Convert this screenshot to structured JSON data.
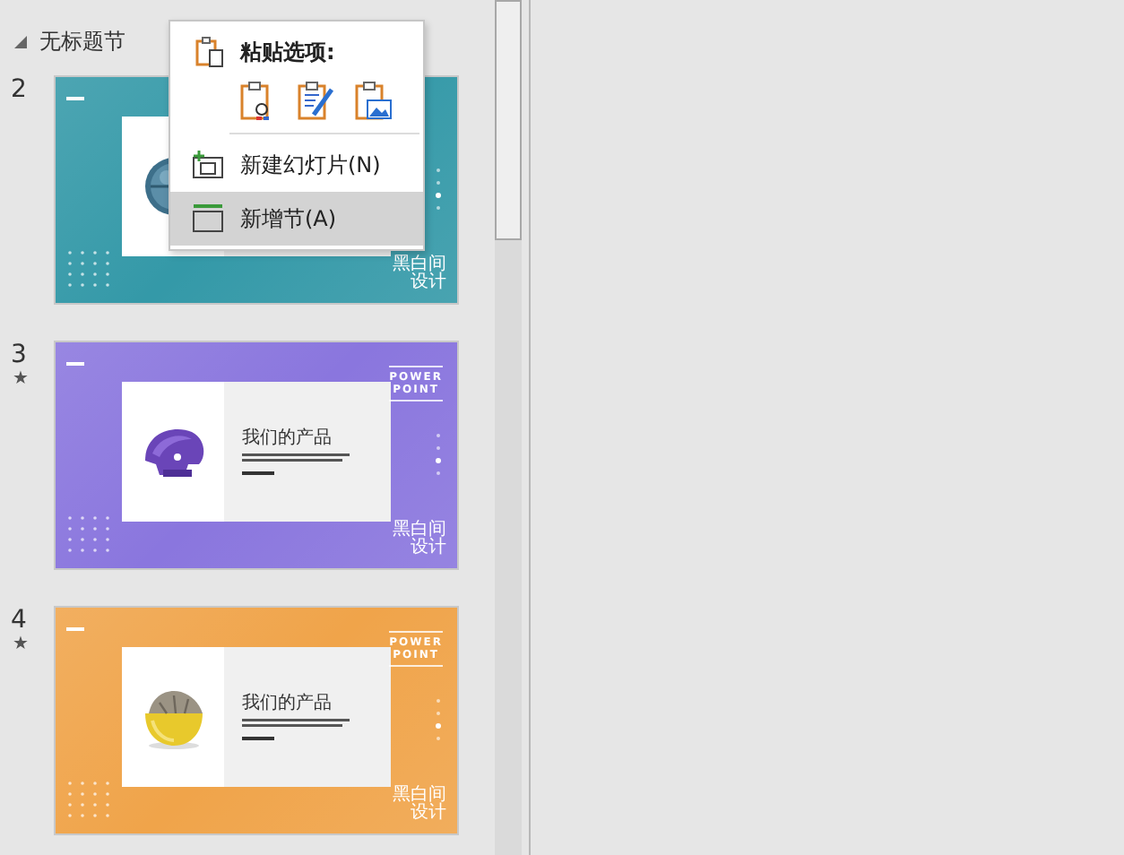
{
  "section": {
    "title": "无标题节",
    "expanded": true
  },
  "slides": [
    {
      "number": "2",
      "color": "#3499a8",
      "kind": "globe",
      "corner_text": [
        "黑白间",
        "设计"
      ]
    },
    {
      "number": "3",
      "star": "★",
      "color": "#8a76de",
      "kind": "helmet",
      "side_title": [
        "POWER",
        "POINT"
      ],
      "card_title": "我们的产品",
      "corner_text": [
        "黑白间",
        "设计"
      ]
    },
    {
      "number": "4",
      "star": "★",
      "color": "#f0a44a",
      "kind": "lemon",
      "side_title": [
        "POWER",
        "POINT"
      ],
      "card_title": "我们的产品",
      "corner_text": [
        "黑白间",
        "设计"
      ]
    }
  ],
  "context_menu": {
    "paste_header": "粘贴选项:",
    "paste_options": [
      {
        "kind": "text"
      },
      {
        "kind": "format"
      },
      {
        "kind": "picture"
      }
    ],
    "items": [
      {
        "label": "新建幻灯片(N)",
        "kind": "new-slide",
        "selected": false
      },
      {
        "label": "新增节(A)",
        "kind": "new-section",
        "selected": true
      }
    ]
  }
}
